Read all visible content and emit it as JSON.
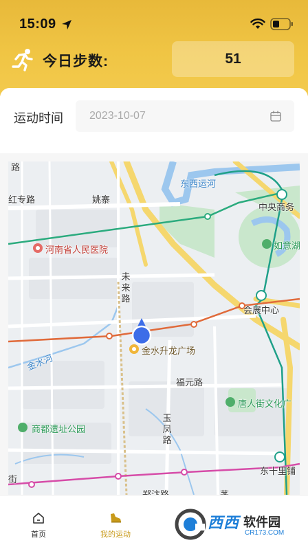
{
  "status_bar": {
    "time": "15:09"
  },
  "header": {
    "steps_label": "今日步数:",
    "steps_value": "51"
  },
  "filter": {
    "label": "运动时间",
    "date_value": "2023-10-07"
  },
  "map": {
    "labels": {
      "lu_top": "路",
      "hongzhuan": "红专路",
      "yaozhai": "姚寨",
      "dongxi_yunhe": "东西运河",
      "zhongyang": "中央商务",
      "hospital": "河南省人民医院",
      "ruyi": "如意湖",
      "weilai": "未来路",
      "huizhan": "会展中心",
      "jinshui_he": "金水河",
      "shenglong": "金水升龙广场",
      "fuyuan": "福元路",
      "tangren": "唐人街文化广",
      "shangdu": "商都遗址公园",
      "yufeng": "玉凤路",
      "dongshili": "东十里铺",
      "jie": "街",
      "zhengbian": "郑汴路",
      "yi": "茅"
    }
  },
  "tabbar": {
    "home": "首页",
    "sport": "我的运动"
  },
  "watermark": {
    "brand": "西西",
    "name": "软件园",
    "url": "CR173.COM"
  }
}
